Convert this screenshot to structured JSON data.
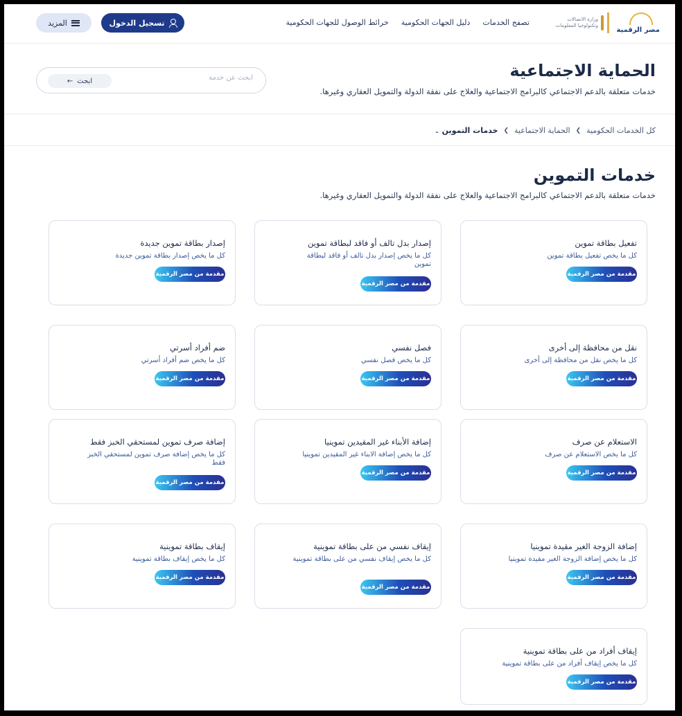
{
  "brand": {
    "name": "مصر الرقمية"
  },
  "ministry": {
    "line1": "وزارة الاتصالات",
    "line2": "وتكنولوجيا المعلومات"
  },
  "nav": {
    "links": [
      "تصفح الخدمات",
      "دليل الجهات الحكومية",
      "خرائط الوصول للجهات الحكومية"
    ],
    "login_label": "تسجيل الدخول",
    "more_label": "المزيد"
  },
  "header": {
    "title": "الحماية الاجتماعية",
    "description": "خدمات متعلقة بالدعم الاجتماعي كالبرامج الاجتماعية والعلاج على نفقة الدولة والتمويل العقاري وغيرها.",
    "search_placeholder": "ابحث عن خدمة",
    "search_button": "ابحث"
  },
  "breadcrumb": {
    "items": [
      "كل الخدمات الحكومية",
      "الحماية الاجتماعية"
    ],
    "current": "خدمات التموين"
  },
  "section": {
    "title": "خدمات التموين",
    "description": "خدمات متعلقة بالدعم الاجتماعي كالبرامج الاجتماعية والعلاج على نفقة الدولة والتمويل العقاري وغيرها."
  },
  "badge_label": "مقدمة من مصر الرقمية",
  "cards": [
    {
      "title": "تفعيل بطاقة تموين",
      "subtitle": "كل ما يخص تفعيل بطاقة تموين"
    },
    {
      "title": "إصدار بدل تالف أو فاقد لبطاقة تموين",
      "subtitle": "كل ما يخص إصدار بدل تالف أو فاقد لبطاقة تموين"
    },
    {
      "title": "إصدار بطاقة تموين جديدة",
      "subtitle": "كل ما يخص إصدار بطاقة تموين جديدة"
    },
    {
      "title": "نقل من محافظة إلى أخرى",
      "subtitle": "كل ما يخص نقل من محافظة إلى أخرى"
    },
    {
      "title": "فصل نفسي",
      "subtitle": "كل ما يخص فصل نفسي"
    },
    {
      "title": "ضم أفراد أسرتي",
      "subtitle": "كل ما يخص ضم أفراد أسرتي"
    },
    {
      "title": "الاستعلام عن صرف",
      "subtitle": "كل ما يخص الاستعلام عن صرف"
    },
    {
      "title": "إضافة الأبناء غير المقيدين تموينيا",
      "subtitle": "كل ما يخص إضافة الابناء غير المقيدين تموينيا"
    },
    {
      "title": "إضافة صرف تموين لمستحقي الخبز فقط",
      "subtitle": "كل ما يخص إضافة صرف تموين لمستحقي الخبز فقط"
    },
    {
      "title": "إضافة الزوجة الغير مقيدة تموينيا",
      "subtitle": "كل ما يخص إضافة الزوجة الغير مقيدة تموينيا"
    },
    {
      "title": "إيقاف نفسي من على بطاقة تموينية",
      "subtitle": "كل ما يخص إيقاف نفسي من على بطاقة تموينية"
    },
    {
      "title": "إيقاف بطاقة تموينية",
      "subtitle": "كل ما يخص إيقاف بطاقة تموينية"
    },
    {
      "title": "إيقاف أفراد من على بطاقة تموينية",
      "subtitle": "كل ما يخص إيقاف أفراد من على بطاقة تموينية"
    }
  ]
}
